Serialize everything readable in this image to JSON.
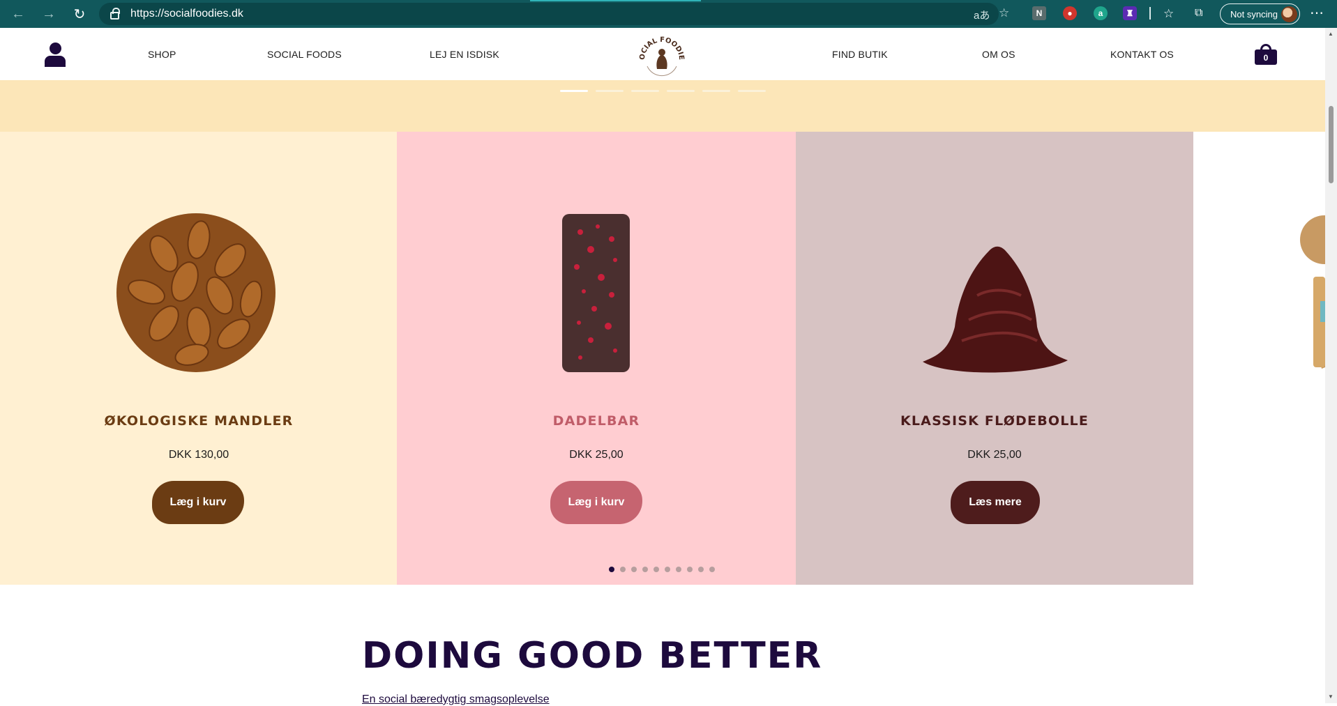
{
  "browser": {
    "url": "https://socialfoodies.dk",
    "sync_label": "Not syncing",
    "more_glyph": "⋯"
  },
  "site_header": {
    "menu_left": [
      "SHOP",
      "SOCIAL FOODS",
      "LEJ EN ISDISK"
    ],
    "menu_right": [
      "FIND BUTIK",
      "OM OS",
      "KONTAKT OS"
    ],
    "logo_text": "SOCIAL FOODIES",
    "cart_count": "0"
  },
  "hero": {
    "slides_total": 6,
    "active_slide": 1
  },
  "products": [
    {
      "name": "ØKOLOGISKE MANDLER",
      "price": "DKK  130,00",
      "button": "Læg i kurv",
      "name_color": "#6b3c13",
      "button_color": "#6b3c13"
    },
    {
      "name": "DADELBAR",
      "price": "DKK  25,00",
      "button": "Læg i kurv",
      "name_color": "#c05c68",
      "button_color": "#c66470"
    },
    {
      "name": "KLASSISK FLØDEBOLLE",
      "price": "DKK  25,00",
      "button": "Læs mere",
      "name_color": "#4a1b1b",
      "button_color": "#4e1c1c"
    }
  ],
  "carousel": {
    "dots_total": 10,
    "active_dot": 1
  },
  "section": {
    "title": "DOING GOOD BETTER",
    "subtitle": "En social bæredygtig smagsoplevelse"
  }
}
